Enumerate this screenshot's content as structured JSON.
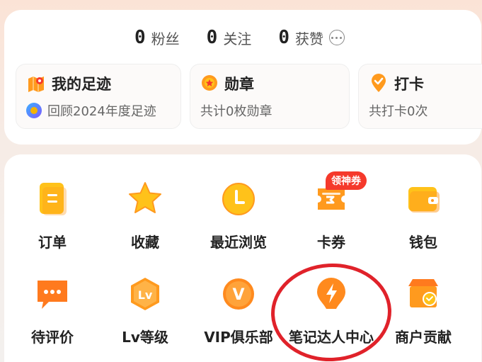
{
  "stats": [
    {
      "num": "0",
      "label": "粉丝"
    },
    {
      "num": "0",
      "label": "关注"
    },
    {
      "num": "0",
      "label": "获赞"
    }
  ],
  "subcards": {
    "footprint": {
      "title": "我的足迹",
      "desc": "回顾2024年度足迹"
    },
    "medal": {
      "title": "勋章",
      "desc": "共计0枚勋章"
    },
    "checkin": {
      "title": "打卡",
      "desc": "共打卡0次"
    }
  },
  "grid": {
    "row1": [
      {
        "label": "订单",
        "icon": "order-icon"
      },
      {
        "label": "收藏",
        "icon": "star-icon"
      },
      {
        "label": "最近浏览",
        "icon": "clock-icon"
      },
      {
        "label": "卡券",
        "icon": "coupon-icon"
      },
      {
        "label": "钱包",
        "icon": "wallet-icon"
      }
    ],
    "row2": [
      {
        "label": "待评价",
        "icon": "comment-icon"
      },
      {
        "label": "Lv等级",
        "icon": "level-icon",
        "icon_text": "Lv"
      },
      {
        "label": "VIP俱乐部",
        "icon": "vip-icon",
        "icon_text": "V"
      },
      {
        "label": "笔记达人中心",
        "icon": "lightning-icon"
      },
      {
        "label": "商户贡献",
        "icon": "shop-icon"
      }
    ]
  },
  "promo_badge": "领神券",
  "colors": {
    "accent_orange": "#ff9a1e",
    "accent_yellow": "#ffc21a",
    "promo_red": "#f5392b",
    "highlight_ring": "#e0222a"
  }
}
